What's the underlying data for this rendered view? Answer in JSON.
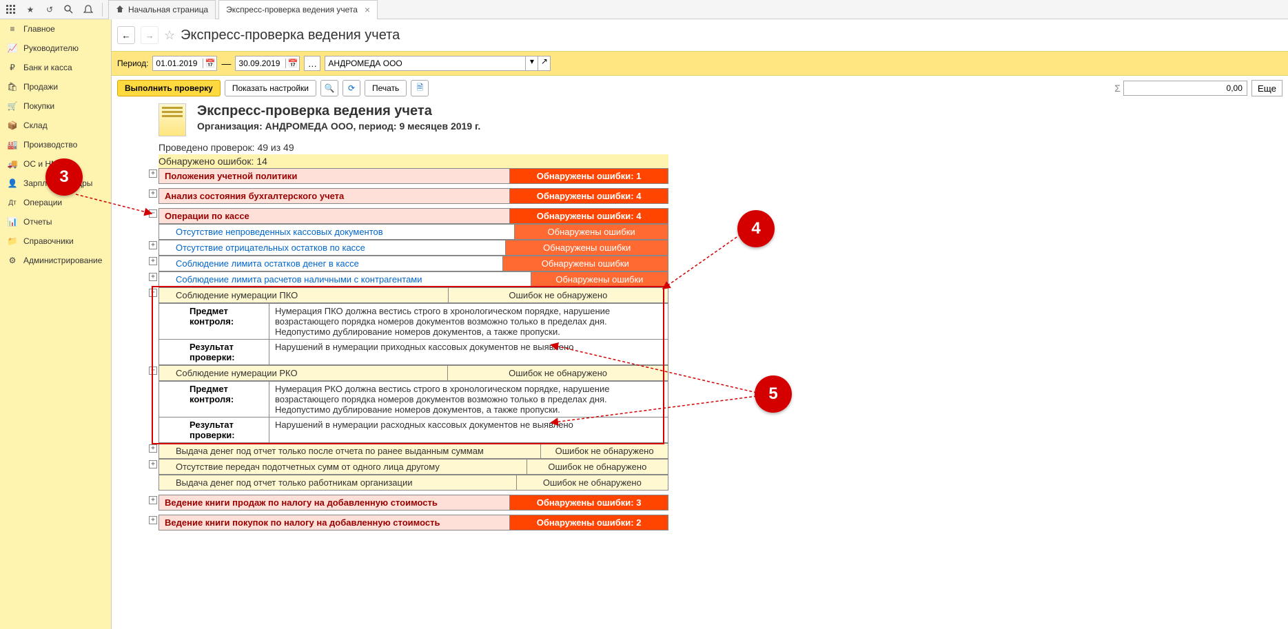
{
  "tabs": {
    "home": "Начальная страница",
    "current": "Экспресс-проверка ведения учета"
  },
  "sidebar": {
    "items": [
      {
        "label": "Главное"
      },
      {
        "label": "Руководителю"
      },
      {
        "label": "Банк и касса"
      },
      {
        "label": "Продажи"
      },
      {
        "label": "Покупки"
      },
      {
        "label": "Склад"
      },
      {
        "label": "Производство"
      },
      {
        "label": "ОС и НМА"
      },
      {
        "label": "Зарплата и кадры"
      },
      {
        "label": "Операции"
      },
      {
        "label": "Отчеты"
      },
      {
        "label": "Справочники"
      },
      {
        "label": "Администрирование"
      }
    ]
  },
  "page": {
    "title": "Экспресс-проверка ведения учета"
  },
  "filter": {
    "period_label": "Период:",
    "date_from": "01.01.2019",
    "date_to": "30.09.2019",
    "org": "АНДРОМЕДА ООО"
  },
  "actions": {
    "run": "Выполнить проверку",
    "settings": "Показать настройки",
    "print": "Печать",
    "more": "Еще",
    "sum": "0,00"
  },
  "report": {
    "title": "Экспресс-проверка ведения учета",
    "subtitle": "Организация: АНДРОМЕДА ООО, период: 9 месяцев 2019 г.",
    "checks_done": "Проведено проверок: 49 из 49",
    "errors_found": "Обнаружено ошибок: 14",
    "sections": [
      {
        "name": "Положения учетной политики",
        "status": "Обнаружены ошибки: 1"
      },
      {
        "name": "Анализ состояния бухгалтерского учета",
        "status": "Обнаружены ошибки: 4"
      },
      {
        "name": "Операции по кассе",
        "status": "Обнаружены ошибки: 4"
      }
    ],
    "cash_checks": [
      {
        "name": "Отсутствие непроведенных кассовых документов",
        "status": "Обнаружены ошибки",
        "err": true
      },
      {
        "name": "Отсутствие отрицательных остатков по кассе",
        "status": "Обнаружены ошибки",
        "err": true
      },
      {
        "name": "Соблюдение лимита остатков денег в кассе",
        "status": "Обнаружены ошибки",
        "err": true
      },
      {
        "name": "Соблюдение лимита расчетов наличными с контрагентами",
        "status": "Обнаружены ошибки",
        "err": true
      },
      {
        "name": "Соблюдение нумерации ПКО",
        "status": "Ошибок не обнаружено",
        "err": false
      },
      {
        "name": "Соблюдение нумерации РКО",
        "status": "Ошибок не обнаружено",
        "err": false
      },
      {
        "name": "Выдача денег под отчет только после отчета по ранее выданным суммам",
        "status": "Ошибок не обнаружено",
        "err": false
      },
      {
        "name": "Отсутствие передач подотчетных сумм от одного лица другому",
        "status": "Ошибок не обнаружено",
        "err": false
      },
      {
        "name": "Выдача денег под отчет только работникам организации",
        "status": "Ошибок не обнаружено",
        "err": false
      }
    ],
    "pko_detail": {
      "subj_label": "Предмет контроля:",
      "subj": "Нумерация ПКО должна вестись строго в хронологическом порядке, нарушение возрастающего порядка номеров документов возможно только в пределах дня. Недопустимо дублирование номеров документов, а также пропуски.",
      "res_label": "Результат проверки:",
      "res": "Нарушений в нумерации приходных кассовых документов не выявлено"
    },
    "rko_detail": {
      "subj_label": "Предмет контроля:",
      "subj": "Нумерация РКО должна вестись строго в хронологическом порядке, нарушение возрастающего порядка номеров документов возможно только в пределах дня. Недопустимо дублирование номеров документов, а также пропуски.",
      "res_label": "Результат проверки:",
      "res": "Нарушений в нумерации расходных кассовых документов не выявлено"
    },
    "sections_after": [
      {
        "name": "Ведение книги продаж по налогу на добавленную стоимость",
        "status": "Обнаружены ошибки: 3"
      },
      {
        "name": "Ведение книги покупок по налогу на добавленную стоимость",
        "status": "Обнаружены ошибки: 2"
      }
    ]
  },
  "annotations": {
    "n3": "3",
    "n4": "4",
    "n5": "5"
  }
}
